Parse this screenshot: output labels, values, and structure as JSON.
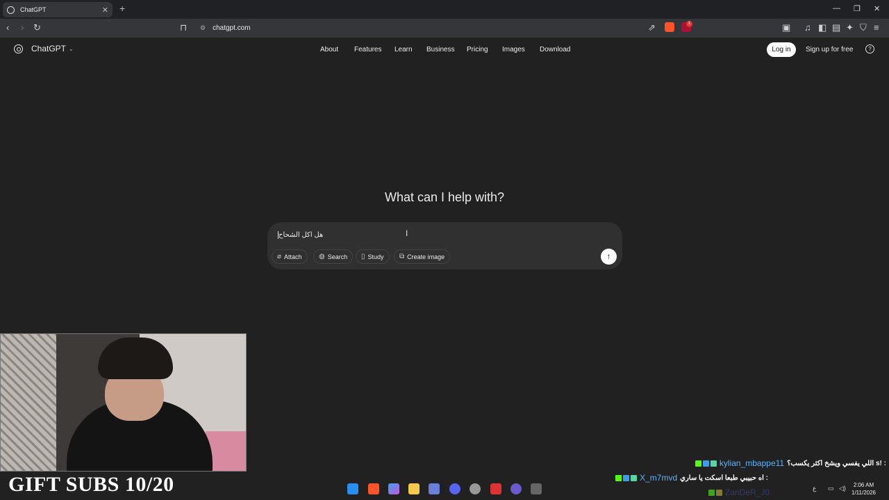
{
  "browser": {
    "tab_title": "ChatGPT",
    "tab_close": "✕",
    "new_tab": "+",
    "url": "chatgpt.com",
    "extension_badge": "1"
  },
  "header": {
    "brand": "ChatGPT",
    "nav": [
      "About",
      "Features",
      "Learn",
      "Business",
      "Pricing",
      "Images",
      "Download"
    ],
    "login": "Log in",
    "signup": "Sign up for free",
    "help": "?"
  },
  "main": {
    "heading": "What can I help with?",
    "input_value": "هل اكل الشحاح",
    "buttons": [
      "Attach",
      "Search",
      "Study",
      "Create image"
    ]
  },
  "overlay": {
    "gift_subs": "GIFT SUBS 10/20",
    "chat": [
      {
        "user": "kylian_mbappe11",
        "message": ": ‏!s ‏اللي يفسي ويشخ اكثر يكسب؟"
      },
      {
        "user": "X_m7mvd",
        "message": ": اه حبيبي طبعا اسكت يا ساري"
      },
      {
        "user": "ZanDeR_J0",
        "message": ""
      }
    ]
  },
  "taskbar": {
    "time": "2:06 AM",
    "date": "1/11/2026",
    "lang": "ع"
  }
}
